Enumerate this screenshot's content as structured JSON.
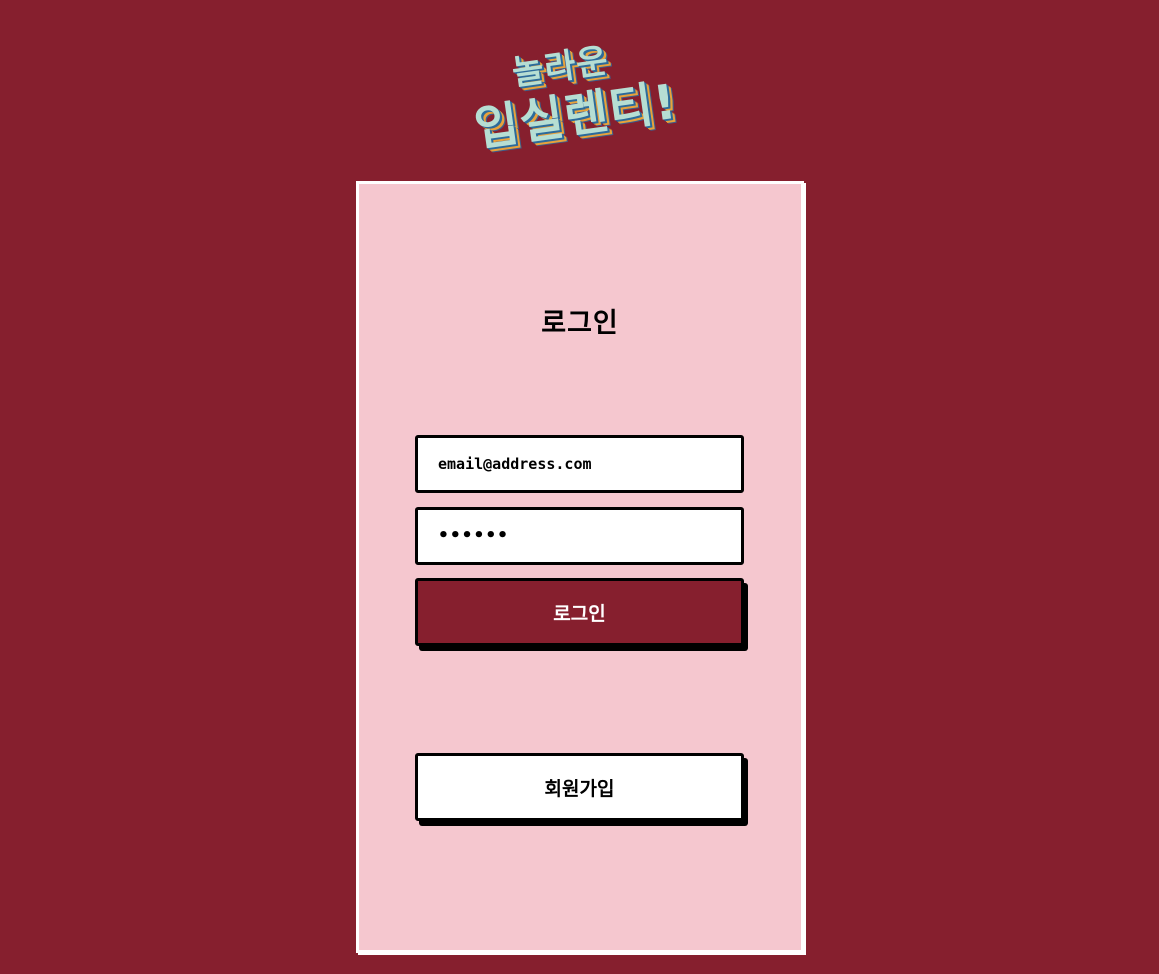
{
  "logo": {
    "line1": "놀라운",
    "line2": "입실렌티!"
  },
  "login_form": {
    "title": "로그인",
    "email_value": "email@address.com",
    "password_value": "••••••",
    "submit_label": "로그인",
    "signup_label": "회원가입"
  },
  "colors": {
    "background": "#861f2e",
    "card": "#f5c7cf",
    "primary_button": "#861f2e",
    "secondary_button": "#ffffff"
  }
}
